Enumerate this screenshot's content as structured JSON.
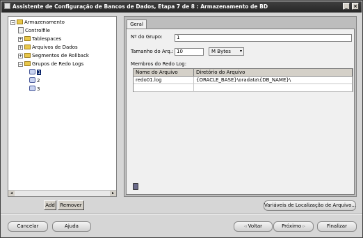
{
  "window": {
    "title": "Assistente de Configuração de Bancos de Dados, Etapa 7 de 8 : Armazenamento de BD",
    "minimize_glyph": "_",
    "close_glyph": "×"
  },
  "tree": {
    "root": {
      "label": "Armazenamento",
      "toggle": "−"
    },
    "items": [
      {
        "label": "Controlfile"
      },
      {
        "label": "Tablespaces",
        "toggle": "+"
      },
      {
        "label": "Arquivos de Dados",
        "toggle": "+"
      },
      {
        "label": "Segmentos de Rollback",
        "toggle": "+"
      },
      {
        "label": "Grupos de Redo Logs",
        "toggle": "−"
      }
    ],
    "redo_groups": [
      "1",
      "2",
      "3"
    ],
    "scroll_left": "◂",
    "scroll_right": "▸"
  },
  "tree_buttons": {
    "add": "Add",
    "remove": "Remover"
  },
  "tab": {
    "label": "Geral"
  },
  "form": {
    "group_label": "Nº do Grupo:",
    "group_value": "1",
    "size_label": "Tamanho do Arq.:",
    "size_value": "10",
    "size_unit": "M Bytes",
    "dropdown_glyph": "▾",
    "members_label": "Membros do Redo Log:"
  },
  "members_table": {
    "headers": [
      "Nome do Arquivo",
      "Diretório do Arquivo"
    ],
    "rows": [
      [
        "redo01.log",
        "{ORACLE_BASE}\\oradata\\{DB_NAME}\\"
      ]
    ]
  },
  "location_button": "Variáveis de Localização de Arquivo...",
  "footer": {
    "cancel": "Cancelar",
    "help": "Ajuda",
    "back": "Voltar",
    "back_glyph": "◃",
    "next": "Próximo",
    "next_glyph": "▹",
    "finish": "Finalizar"
  }
}
